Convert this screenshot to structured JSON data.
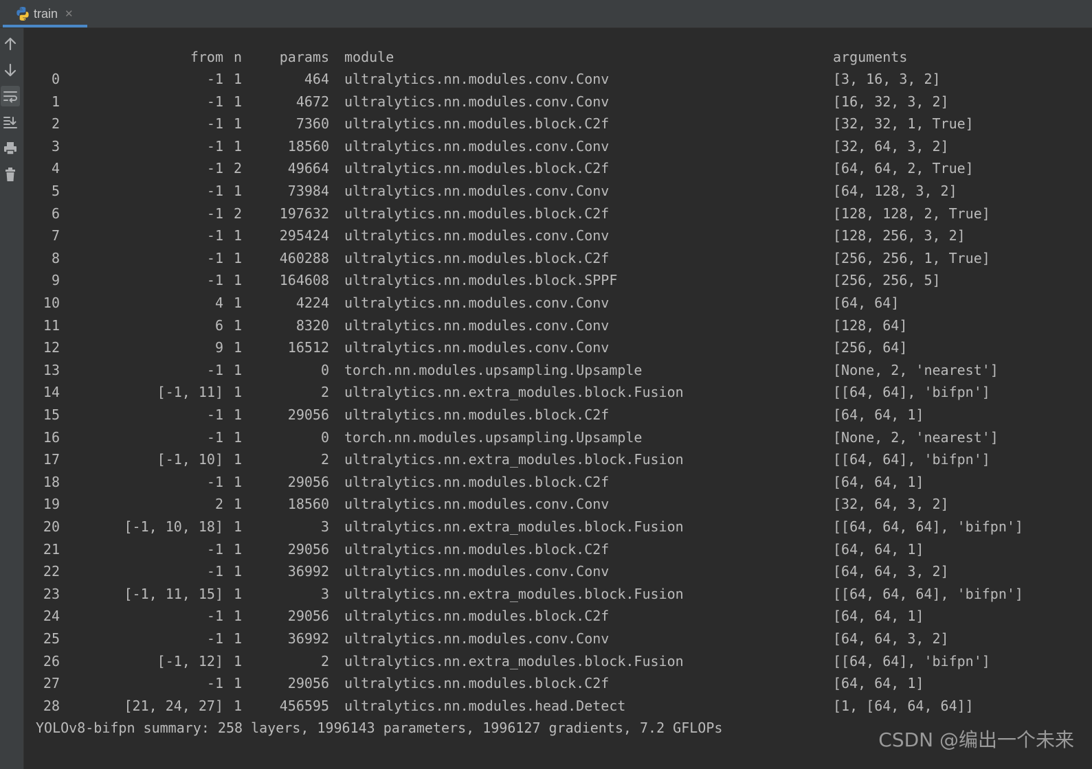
{
  "tab": {
    "label": "train",
    "close": "✕",
    "icon": "python-icon"
  },
  "sidebar": {
    "buttons": [
      {
        "icon": "arrow-up-icon"
      },
      {
        "icon": "arrow-down-icon"
      },
      {
        "icon": "soft-wrap-icon"
      },
      {
        "icon": "scroll-to-end-icon"
      },
      {
        "icon": "print-icon"
      },
      {
        "icon": "trash-icon"
      }
    ]
  },
  "console": {
    "header": {
      "idx": "",
      "from": "from",
      "n": "n",
      "params": "params",
      "module": "module",
      "args": "arguments"
    },
    "rows": [
      {
        "idx": "0",
        "from": "-1",
        "n": "1",
        "params": "464",
        "module": "ultralytics.nn.modules.conv.Conv",
        "args": "[3, 16, 3, 2]"
      },
      {
        "idx": "1",
        "from": "-1",
        "n": "1",
        "params": "4672",
        "module": "ultralytics.nn.modules.conv.Conv",
        "args": "[16, 32, 3, 2]"
      },
      {
        "idx": "2",
        "from": "-1",
        "n": "1",
        "params": "7360",
        "module": "ultralytics.nn.modules.block.C2f",
        "args": "[32, 32, 1, True]"
      },
      {
        "idx": "3",
        "from": "-1",
        "n": "1",
        "params": "18560",
        "module": "ultralytics.nn.modules.conv.Conv",
        "args": "[32, 64, 3, 2]"
      },
      {
        "idx": "4",
        "from": "-1",
        "n": "2",
        "params": "49664",
        "module": "ultralytics.nn.modules.block.C2f",
        "args": "[64, 64, 2, True]"
      },
      {
        "idx": "5",
        "from": "-1",
        "n": "1",
        "params": "73984",
        "module": "ultralytics.nn.modules.conv.Conv",
        "args": "[64, 128, 3, 2]"
      },
      {
        "idx": "6",
        "from": "-1",
        "n": "2",
        "params": "197632",
        "module": "ultralytics.nn.modules.block.C2f",
        "args": "[128, 128, 2, True]"
      },
      {
        "idx": "7",
        "from": "-1",
        "n": "1",
        "params": "295424",
        "module": "ultralytics.nn.modules.conv.Conv",
        "args": "[128, 256, 3, 2]"
      },
      {
        "idx": "8",
        "from": "-1",
        "n": "1",
        "params": "460288",
        "module": "ultralytics.nn.modules.block.C2f",
        "args": "[256, 256, 1, True]"
      },
      {
        "idx": "9",
        "from": "-1",
        "n": "1",
        "params": "164608",
        "module": "ultralytics.nn.modules.block.SPPF",
        "args": "[256, 256, 5]"
      },
      {
        "idx": "10",
        "from": "4",
        "n": "1",
        "params": "4224",
        "module": "ultralytics.nn.modules.conv.Conv",
        "args": "[64, 64]"
      },
      {
        "idx": "11",
        "from": "6",
        "n": "1",
        "params": "8320",
        "module": "ultralytics.nn.modules.conv.Conv",
        "args": "[128, 64]"
      },
      {
        "idx": "12",
        "from": "9",
        "n": "1",
        "params": "16512",
        "module": "ultralytics.nn.modules.conv.Conv",
        "args": "[256, 64]"
      },
      {
        "idx": "13",
        "from": "-1",
        "n": "1",
        "params": "0",
        "module": "torch.nn.modules.upsampling.Upsample",
        "args": "[None, 2, 'nearest']"
      },
      {
        "idx": "14",
        "from": "[-1, 11]",
        "n": "1",
        "params": "2",
        "module": "ultralytics.nn.extra_modules.block.Fusion",
        "args": "[[64, 64], 'bifpn']"
      },
      {
        "idx": "15",
        "from": "-1",
        "n": "1",
        "params": "29056",
        "module": "ultralytics.nn.modules.block.C2f",
        "args": "[64, 64, 1]"
      },
      {
        "idx": "16",
        "from": "-1",
        "n": "1",
        "params": "0",
        "module": "torch.nn.modules.upsampling.Upsample",
        "args": "[None, 2, 'nearest']"
      },
      {
        "idx": "17",
        "from": "[-1, 10]",
        "n": "1",
        "params": "2",
        "module": "ultralytics.nn.extra_modules.block.Fusion",
        "args": "[[64, 64], 'bifpn']"
      },
      {
        "idx": "18",
        "from": "-1",
        "n": "1",
        "params": "29056",
        "module": "ultralytics.nn.modules.block.C2f",
        "args": "[64, 64, 1]"
      },
      {
        "idx": "19",
        "from": "2",
        "n": "1",
        "params": "18560",
        "module": "ultralytics.nn.modules.conv.Conv",
        "args": "[32, 64, 3, 2]"
      },
      {
        "idx": "20",
        "from": "[-1, 10, 18]",
        "n": "1",
        "params": "3",
        "module": "ultralytics.nn.extra_modules.block.Fusion",
        "args": "[[64, 64, 64], 'bifpn']"
      },
      {
        "idx": "21",
        "from": "-1",
        "n": "1",
        "params": "29056",
        "module": "ultralytics.nn.modules.block.C2f",
        "args": "[64, 64, 1]"
      },
      {
        "idx": "22",
        "from": "-1",
        "n": "1",
        "params": "36992",
        "module": "ultralytics.nn.modules.conv.Conv",
        "args": "[64, 64, 3, 2]"
      },
      {
        "idx": "23",
        "from": "[-1, 11, 15]",
        "n": "1",
        "params": "3",
        "module": "ultralytics.nn.extra_modules.block.Fusion",
        "args": "[[64, 64, 64], 'bifpn']"
      },
      {
        "idx": "24",
        "from": "-1",
        "n": "1",
        "params": "29056",
        "module": "ultralytics.nn.modules.block.C2f",
        "args": "[64, 64, 1]"
      },
      {
        "idx": "25",
        "from": "-1",
        "n": "1",
        "params": "36992",
        "module": "ultralytics.nn.modules.conv.Conv",
        "args": "[64, 64, 3, 2]"
      },
      {
        "idx": "26",
        "from": "[-1, 12]",
        "n": "1",
        "params": "2",
        "module": "ultralytics.nn.extra_modules.block.Fusion",
        "args": "[[64, 64], 'bifpn']"
      },
      {
        "idx": "27",
        "from": "-1",
        "n": "1",
        "params": "29056",
        "module": "ultralytics.nn.modules.block.C2f",
        "args": "[64, 64, 1]"
      },
      {
        "idx": "28",
        "from": "[21, 24, 27]",
        "n": "1",
        "params": "456595",
        "module": "ultralytics.nn.modules.head.Detect",
        "args": "[1, [64, 64, 64]]"
      }
    ],
    "summary": "YOLOv8-bifpn summary: 258 layers, 1996143 parameters, 1996127 gradients, 7.2 GFLOPs"
  },
  "watermark": "CSDN @编出一个未来"
}
